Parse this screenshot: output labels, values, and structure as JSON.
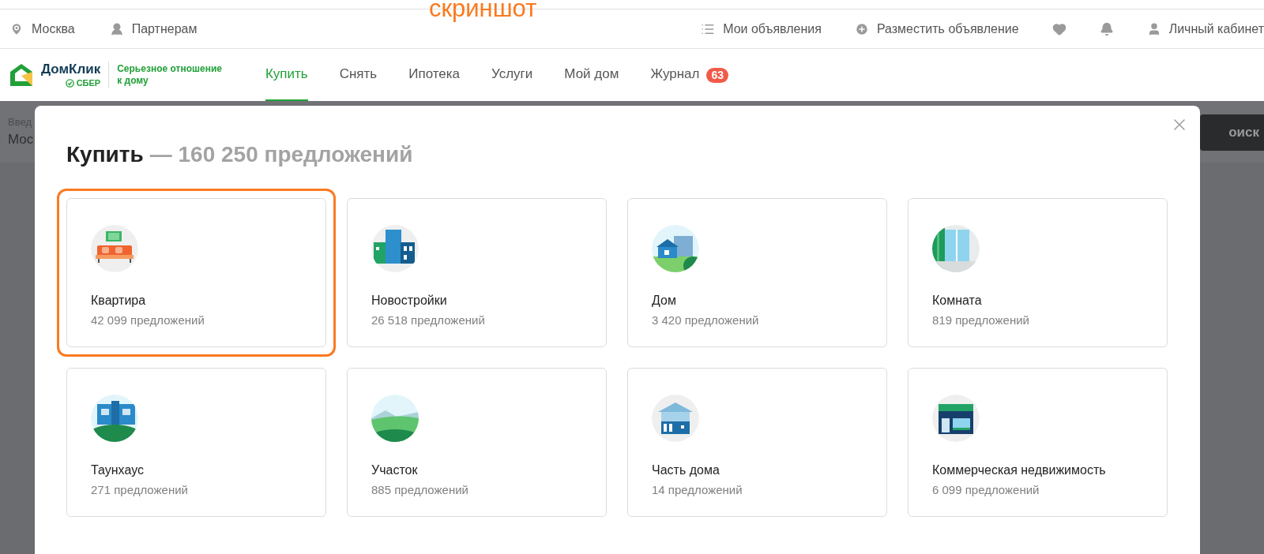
{
  "annotation": {
    "text": "скриншот"
  },
  "top_bar": {
    "left": [
      {
        "kind": "pin",
        "label": "Москва"
      },
      {
        "kind": "person",
        "label": "Партнерам"
      }
    ],
    "right": [
      {
        "kind": "list",
        "label": "Мои объявления"
      },
      {
        "kind": "plus",
        "label": "Разместить объявление"
      },
      {
        "kind": "heart"
      },
      {
        "kind": "bell"
      },
      {
        "kind": "user",
        "label": "Личный кабинет"
      }
    ]
  },
  "logo": {
    "name": "ДомКлик",
    "sub": "СБЕР",
    "slogan": [
      "Серьезное отношение",
      "к дому"
    ]
  },
  "nav": [
    {
      "label": "Купить",
      "selected": true
    },
    {
      "label": "Снять",
      "selected": false
    },
    {
      "label": "Ипотека",
      "selected": false
    },
    {
      "label": "Услуги",
      "selected": false
    },
    {
      "label": "Мой дом",
      "selected": false
    },
    {
      "label": "Журнал",
      "selected": false,
      "badge": "63"
    }
  ],
  "background": {
    "search_label": "Введ",
    "search_value": "Мос",
    "search_button": "оиск"
  },
  "modal": {
    "title": "Купить",
    "total": "— 160 250 предложений",
    "cards": [
      {
        "kind": "apartment",
        "name": "Квартира",
        "count": "42 099 предложений",
        "highlighted": true
      },
      {
        "kind": "newbuild",
        "name": "Новостройки",
        "count": "26 518 предложений",
        "highlighted": false
      },
      {
        "kind": "house",
        "name": "Дом",
        "count": "3 420 предложений",
        "highlighted": false
      },
      {
        "kind": "room",
        "name": "Комната",
        "count": "819 предложений",
        "highlighted": false
      },
      {
        "kind": "townhouse",
        "name": "Таунхаус",
        "count": "271 предложений",
        "highlighted": false
      },
      {
        "kind": "plot",
        "name": "Участок",
        "count": "885 предложений",
        "highlighted": false
      },
      {
        "kind": "house-part",
        "name": "Часть дома",
        "count": "14 предложений",
        "highlighted": false
      },
      {
        "kind": "commercial",
        "name": "Коммерческая недвижимость",
        "count": "6 099 предложений",
        "highlighted": false
      }
    ]
  }
}
